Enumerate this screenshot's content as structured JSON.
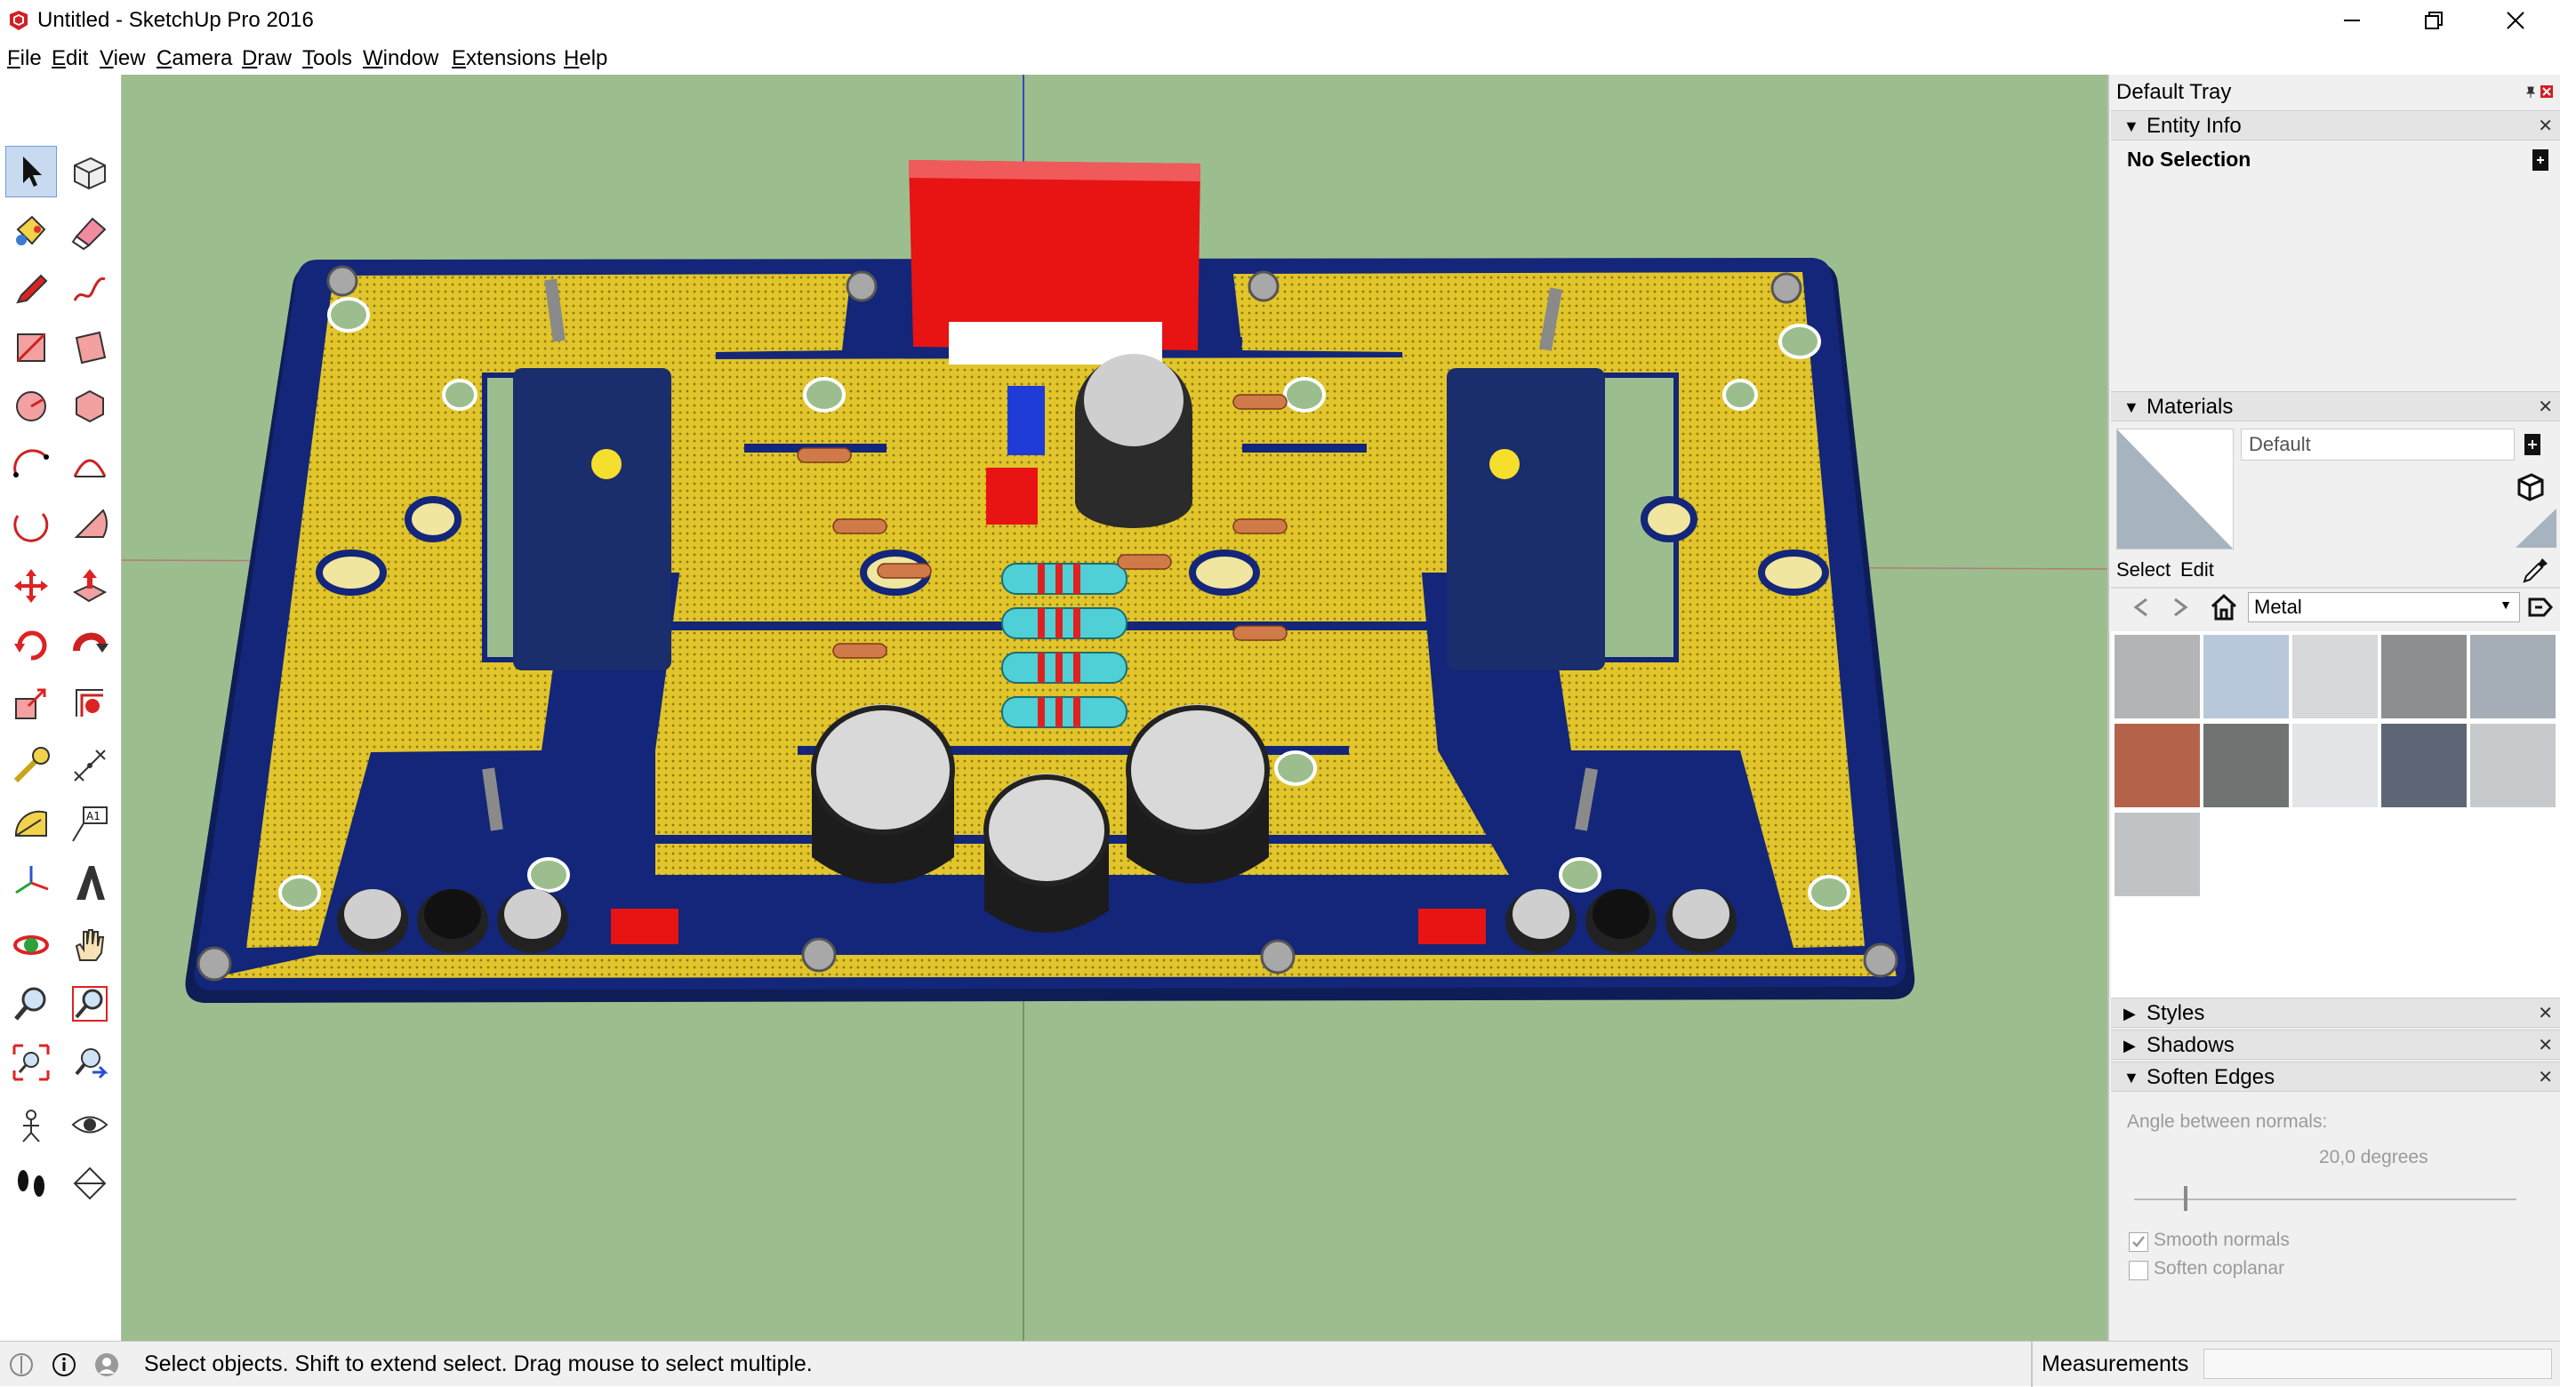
{
  "window": {
    "title": "Untitled - SketchUp Pro 2016",
    "controls": [
      "minimize-icon",
      "restore-icon",
      "close-icon"
    ]
  },
  "menu": [
    {
      "label": "File",
      "accel": "F",
      "rest": "ile"
    },
    {
      "label": "Edit",
      "accel": "E",
      "rest": "dit"
    },
    {
      "label": "View",
      "accel": "V",
      "rest": "iew"
    },
    {
      "label": "Camera",
      "accel": "C",
      "rest": "amera"
    },
    {
      "label": "Draw",
      "accel": "D",
      "rest": "raw"
    },
    {
      "label": "Tools",
      "accel": "T",
      "rest": "ools"
    },
    {
      "label": "Window",
      "accel": "W",
      "rest": "indow"
    },
    {
      "label": "Extensions",
      "accel": "E",
      "rest": "xtensions"
    },
    {
      "label": "Help",
      "accel": "H",
      "rest": "elp"
    }
  ],
  "toolbar": {
    "tools": [
      "select",
      "make-component",
      "paint-bucket",
      "eraser",
      "line",
      "freehand",
      "rectangle",
      "rotated-rectangle",
      "circle",
      "polygon",
      "arc",
      "2-point-arc",
      "3-point-arc",
      "pie",
      "move",
      "push-pull",
      "rotate",
      "follow-me",
      "scale",
      "offset",
      "tape-measure",
      "dimension",
      "protractor",
      "text",
      "axes",
      "3d-text",
      "orbit",
      "pan",
      "zoom",
      "zoom-window",
      "zoom-extents",
      "previous",
      "position-camera",
      "look-around",
      "walk",
      "section-plane"
    ],
    "text_tool_label": "A1",
    "selected": "select"
  },
  "tray": {
    "title": "Default Tray",
    "entity_info": {
      "header": "Entity Info",
      "selection": "No Selection"
    },
    "materials": {
      "header": "Materials",
      "current_name": "Default",
      "tabs": [
        "Select",
        "Edit"
      ],
      "library": "Metal",
      "swatch_colors": [
        "#b2b4b5",
        "#b8c8da",
        "#d6d8d9",
        "#8c8e8f",
        "#a5aeb6",
        "#b5624a",
        "#6f7473",
        "#e3e4e7",
        "#5c6675",
        "#c7cacc",
        "#bfc3c6"
      ]
    },
    "styles_header": "Styles",
    "shadows_header": "Shadows",
    "soften_edges": {
      "header": "Soften Edges",
      "angle_label": "Angle between normals:",
      "angle_value": "20,0  degrees",
      "smooth_normals_label": "Smooth normals",
      "smooth_normals_checked": true,
      "soften_coplanar_label": "Soften coplanar",
      "soften_coplanar_checked": false
    }
  },
  "status": {
    "message": "Select objects. Shift to extend select. Drag mouse to select multiple.",
    "measurements_label": "Measurements",
    "measurements_value": ""
  },
  "colors": {
    "viewport_bg": "#9cbe8e",
    "pcb_gold": "#e2c52a",
    "pcb_blue": "#0f2167",
    "relay_red": "#e81313",
    "capacitor": "#2b2b2b"
  }
}
